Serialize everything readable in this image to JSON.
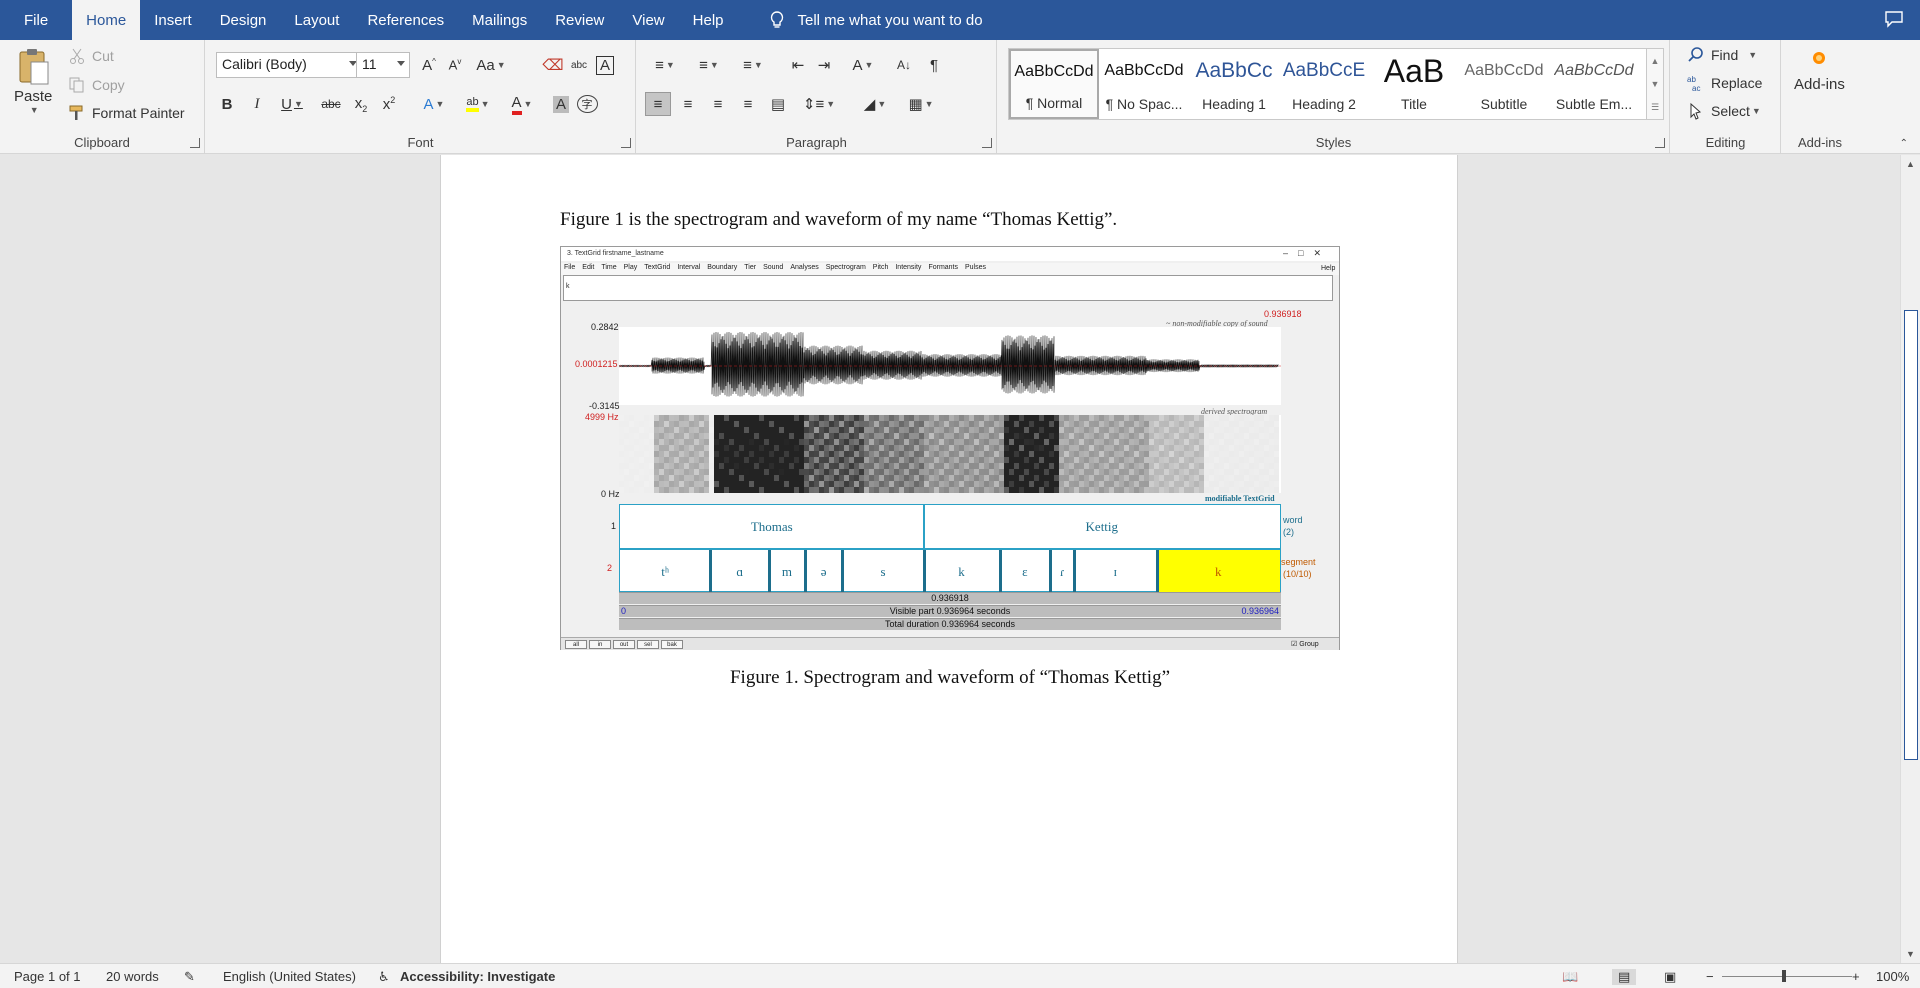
{
  "tabs": [
    "File",
    "Home",
    "Insert",
    "Design",
    "Layout",
    "References",
    "Mailings",
    "Review",
    "View",
    "Help"
  ],
  "active_tab": "Home",
  "tell_me": "Tell me what you want to do",
  "clipboard": {
    "paste": "Paste",
    "cut": "Cut",
    "copy": "Copy",
    "format_painter": "Format Painter",
    "label": "Clipboard"
  },
  "font": {
    "name": "Calibri (Body)",
    "size": "11",
    "label": "Font"
  },
  "paragraph": {
    "label": "Paragraph"
  },
  "styles": {
    "label": "Styles",
    "items": [
      {
        "preview": "AaBbCcDd",
        "name": "¶ Normal"
      },
      {
        "preview": "AaBbCcDd",
        "name": "¶ No Spac..."
      },
      {
        "preview": "AaBbCc",
        "name": "Heading 1"
      },
      {
        "preview": "AaBbCcE",
        "name": "Heading 2"
      },
      {
        "preview": "AaB",
        "name": "Title"
      },
      {
        "preview": "AaBbCcDd",
        "name": "Subtitle"
      },
      {
        "preview": "AaBbCcDd",
        "name": "Subtle Em..."
      }
    ]
  },
  "editing": {
    "find": "Find",
    "replace": "Replace",
    "select": "Select",
    "label": "Editing"
  },
  "addins": {
    "button": "Add-ins",
    "label": "Add-ins"
  },
  "document": {
    "intro": "Figure 1 is the spectrogram and waveform of my name “Thomas Kettig”.",
    "caption": "Figure 1. Spectrogram and waveform of “Thomas Kettig”"
  },
  "praat": {
    "title": "3. TextGrid firstname_lastname",
    "menus": [
      "File",
      "Edit",
      "Time",
      "Play",
      "TextGrid",
      "Interval",
      "Boundary",
      "Tier",
      "Sound",
      "Analyses",
      "Spectrogram",
      "Pitch",
      "Intensity",
      "Formants",
      "Pulses"
    ],
    "help": "Help",
    "text_value": "k",
    "cursor_time": "0.936918",
    "wave_max": "0.2842",
    "wave_mid": "0.0001215",
    "wave_min": "-0.3145",
    "spec_max": "4999 Hz",
    "spec_min": "0 Hz",
    "sound_label": "~ non-modifiable copy of sound",
    "spec_label": "derived spectrogram",
    "tg_label": "modifiable TextGrid",
    "tier1_num": "1",
    "tier2_num": "2",
    "tier1_name": "word",
    "tier1_count": "(2)",
    "tier2_name": "segment",
    "tier2_count": "(10/10)",
    "words": [
      "Thomas",
      "Kettig"
    ],
    "segments": [
      "tʰ",
      "ɑ",
      "m",
      "ə",
      "s",
      "k",
      "ɛ",
      "ɾ",
      "ɪ",
      "k"
    ],
    "sel_time": "0.936918",
    "visible_start": "0",
    "visible_label": "Visible part 0.936964 seconds",
    "visible_end": "0.936964",
    "total_label": "Total duration 0.936964 seconds",
    "buttons": [
      "all",
      "in",
      "out",
      "sel",
      "bak"
    ],
    "group": "Group"
  },
  "status": {
    "page": "Page 1 of 1",
    "words": "20 words",
    "language": "English (United States)",
    "accessibility": "Accessibility: Investigate",
    "zoom": "100%"
  },
  "colors": {
    "brand": "#2b579a",
    "praat_cyan": "#2ba1c6",
    "praat_red": "#d02020",
    "highlight": "#ffff00"
  }
}
